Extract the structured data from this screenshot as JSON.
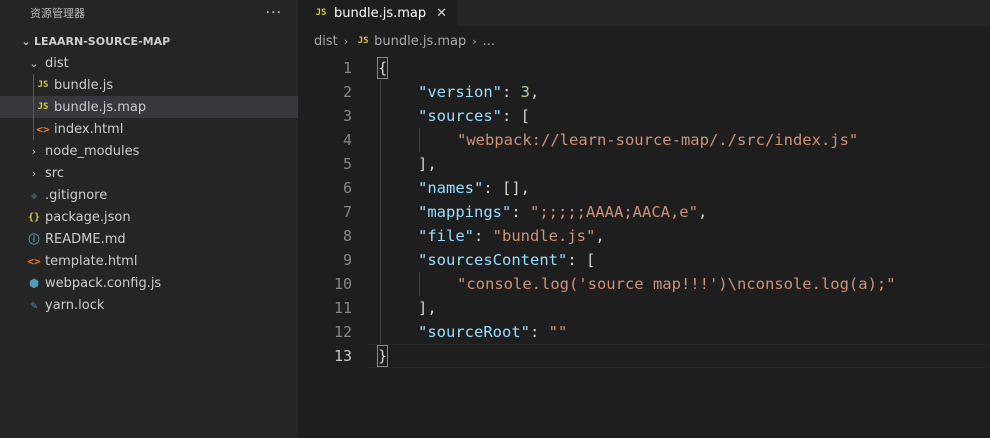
{
  "sidebar": {
    "title": "资源管理器",
    "more": "···",
    "project": "LEAARN-SOURCE-MAP",
    "tree": {
      "dist": "dist",
      "bundle_js": "bundle.js",
      "bundle_map": "bundle.js.map",
      "index_html": "index.html",
      "node_modules": "node_modules",
      "src": "src",
      "gitignore": ".gitignore",
      "package_json": "package.json",
      "readme": "README.md",
      "template": "template.html",
      "webpack": "webpack.config.js",
      "yarn": "yarn.lock"
    },
    "icons": {
      "js": "JS",
      "html": "<>",
      "json": "{}",
      "info": "ⓘ",
      "git": "◆",
      "webpack": "⬢",
      "yarn": "✎",
      "chevron_down": "⌄",
      "chevron_right": "›"
    }
  },
  "editor": {
    "tab_label": "bundle.js.map",
    "tab_close": "✕",
    "breadcrumb": {
      "folder": "dist",
      "file": "bundle.js.map",
      "more": "..."
    },
    "line_numbers": [
      "1",
      "2",
      "3",
      "4",
      "5",
      "6",
      "7",
      "8",
      "9",
      "10",
      "11",
      "12",
      "13"
    ],
    "code": {
      "l1": "{",
      "l2_key": "\"version\"",
      "l2_colon": ": ",
      "l2_val": "3",
      "l2_end": ",",
      "l3_key": "\"sources\"",
      "l3_rest": ": [",
      "l4_val": "\"webpack://learn-source-map/./src/index.js\"",
      "l5": "],",
      "l6_key": "\"names\"",
      "l6_rest": ": [],",
      "l7_key": "\"mappings\"",
      "l7_colon": ": ",
      "l7_val": "\";;;;;AAAA;AACA,e\"",
      "l7_end": ",",
      "l8_key": "\"file\"",
      "l8_colon": ": ",
      "l8_val": "\"bundle.js\"",
      "l8_end": ",",
      "l9_key": "\"sourcesContent\"",
      "l9_rest": ": [",
      "l10_val": "\"console.log('source map!!!')\\nconsole.log(a);\"",
      "l11": "],",
      "l12_key": "\"sourceRoot\"",
      "l12_colon": ": ",
      "l12_val": "\"\"",
      "l13": "}"
    }
  },
  "colors": {
    "key": "#9cdcfe",
    "string": "#ce9178",
    "number": "#b5cea8",
    "js_icon": "#cbcb41",
    "html_icon": "#e37933",
    "info_icon": "#519aba"
  }
}
